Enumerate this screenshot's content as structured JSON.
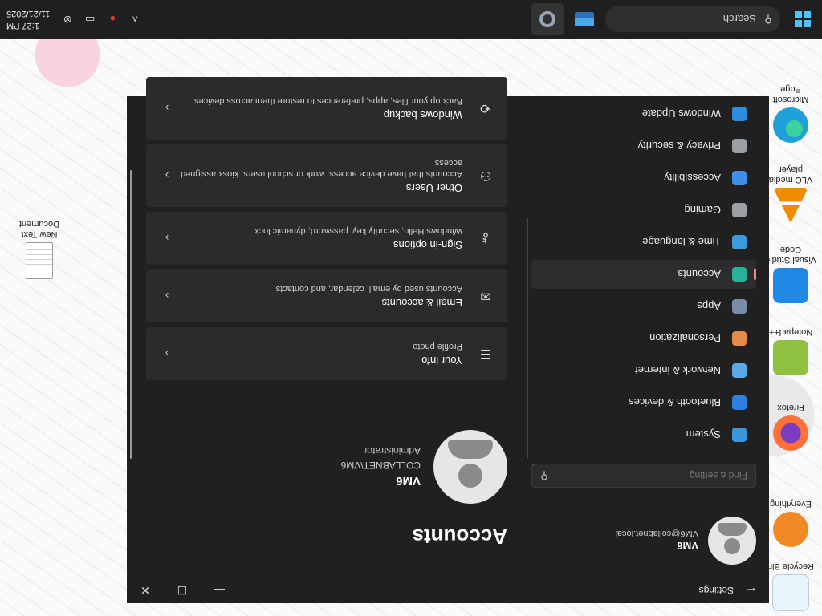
{
  "desktop": {
    "icons": [
      {
        "label": "Recycle Bin",
        "icon": "recycle-bin-icon",
        "color": "#e8f4fc"
      },
      {
        "label": "Everything",
        "icon": "everything-icon",
        "color": "#f08a24"
      },
      {
        "label": "Firefox",
        "icon": "firefox-icon",
        "color": "#ff7139"
      },
      {
        "label": "Notepad++",
        "icon": "notepad-plus-plus-icon",
        "color": "#90c040"
      },
      {
        "label": "Visual Studio Code",
        "icon": "vscode-icon",
        "color": "#1e88e5"
      },
      {
        "label": "VLC media player",
        "icon": "vlc-icon",
        "color": "#f08c00"
      },
      {
        "label": "Microsoft Edge",
        "icon": "edge-icon",
        "color": "#1fa0d8"
      },
      {
        "label": "New Text Document",
        "icon": "text-document-icon",
        "color": "#f4f4f4"
      }
    ]
  },
  "window": {
    "title": "Settings",
    "controls": {
      "minimize": "—",
      "maximize": "☐",
      "close": "✕"
    }
  },
  "sidebar": {
    "user_name": "VM6",
    "user_email": "VM6@collabnet.local",
    "search_placeholder": "Find a setting",
    "nav": [
      {
        "label": "System",
        "icon": "system-icon",
        "color": "#3a96dd",
        "active": false
      },
      {
        "label": "Bluetooth & devices",
        "icon": "bluetooth-icon",
        "color": "#2f7fe0",
        "active": false
      },
      {
        "label": "Network & internet",
        "icon": "network-icon",
        "color": "#5aa8e8",
        "active": false
      },
      {
        "label": "Personalization",
        "icon": "brush-icon",
        "color": "#e58a4b",
        "active": false
      },
      {
        "label": "Apps",
        "icon": "apps-icon",
        "color": "#7a8da8",
        "active": false
      },
      {
        "label": "Accounts",
        "icon": "accounts-icon",
        "color": "#27b39b",
        "active": true
      },
      {
        "label": "Time & language",
        "icon": "globe-clock-icon",
        "color": "#3a9be0",
        "active": false
      },
      {
        "label": "Gaming",
        "icon": "gamepad-icon",
        "color": "#9aa0a6",
        "active": false
      },
      {
        "label": "Accessibility",
        "icon": "accessibility-icon",
        "color": "#3f8ee8",
        "active": false
      },
      {
        "label": "Privacy & security",
        "icon": "shield-icon",
        "color": "#9aa0a6",
        "active": false
      },
      {
        "label": "Windows Update",
        "icon": "update-icon",
        "color": "#2d8de0",
        "active": false
      }
    ]
  },
  "main": {
    "title": "Accounts",
    "profile": {
      "name": "VM6",
      "domain": "COLLABNET\\VM6",
      "role": "Administrator"
    },
    "cards": [
      {
        "title": "Your info",
        "desc": "Profile photo",
        "icon": "your-info-icon",
        "glyph": "☰"
      },
      {
        "title": "Email & accounts",
        "desc": "Accounts used by email, calendar, and contacts",
        "icon": "mail-icon",
        "glyph": "✉"
      },
      {
        "title": "Sign-in options",
        "desc": "Windows Hello, security key, password, dynamic lock",
        "icon": "key-icon",
        "glyph": "⚷"
      },
      {
        "title": "Other Users",
        "desc": "Accounts that have device access, work or school users, kiosk assigned access",
        "icon": "other-users-icon",
        "glyph": "⚇"
      },
      {
        "title": "Windows backup",
        "desc": "Back up your files, apps, preferences to restore them across devices",
        "icon": "backup-icon",
        "glyph": "⟲"
      }
    ]
  },
  "taskbar": {
    "search_placeholder": "Search",
    "time": "1:27 PM",
    "date": "11/21/2025"
  }
}
